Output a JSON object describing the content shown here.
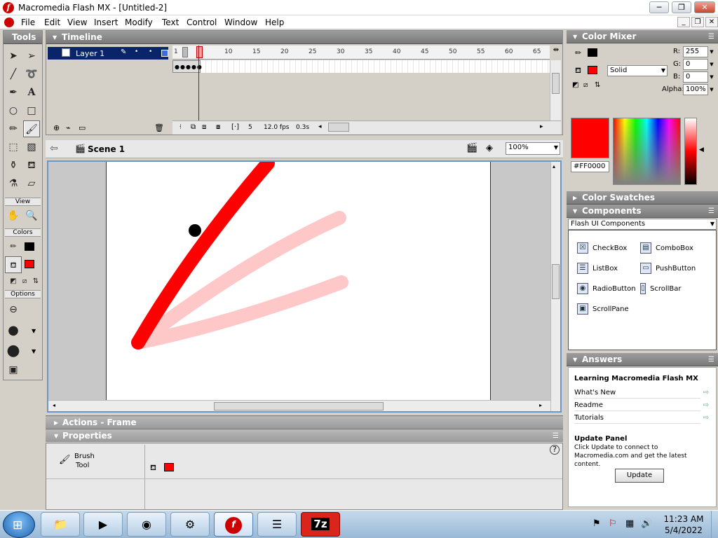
{
  "window": {
    "title": "Macromedia Flash MX - [Untitled-2]",
    "minimize": "─",
    "maximize": "❐",
    "close": "✕"
  },
  "menu": [
    "File",
    "Edit",
    "View",
    "Insert",
    "Modify",
    "Text",
    "Control",
    "Window",
    "Help"
  ],
  "tools_panel": {
    "title": "Tools",
    "sections": {
      "view": "View",
      "colors": "Colors",
      "options": "Options"
    }
  },
  "timeline": {
    "title": "Timeline",
    "layer_name": "Layer 1",
    "frame_numbers": [
      "1",
      "5",
      "10",
      "15",
      "20",
      "25",
      "30",
      "35",
      "40",
      "45",
      "50",
      "55",
      "60",
      "65"
    ],
    "current_frame": "5",
    "fps": "12.0 fps",
    "elapsed": "0.3s"
  },
  "scene": {
    "name": "Scene 1",
    "zoom": "100%"
  },
  "panels": {
    "actions": "Actions - Frame",
    "properties": "Properties"
  },
  "properties": {
    "tool_name_line1": "Brush",
    "tool_name_line2": "Tool"
  },
  "color_mixer": {
    "title": "Color Mixer",
    "r_label": "R:",
    "r": "255",
    "g_label": "G:",
    "g": "0",
    "b_label": "B:",
    "b": "0",
    "alpha_label": "Alpha:",
    "alpha": "100%",
    "fill_type": "Solid",
    "hex": "#FF0000"
  },
  "color_swatches": {
    "title": "Color Swatches"
  },
  "components": {
    "title": "Components",
    "set": "Flash UI Components",
    "items": [
      "CheckBox",
      "ComboBox",
      "ListBox",
      "PushButton",
      "RadioButton",
      "ScrollBar",
      "ScrollPane"
    ]
  },
  "answers": {
    "title": "Answers",
    "heading": "Learning Macromedia Flash MX",
    "links": [
      "What's New",
      "Readme",
      "Tutorials"
    ],
    "update_heading": "Update Panel",
    "update_text": "Click Update to connect to Macromedia.com and get the latest content.",
    "update_button": "Update"
  },
  "taskbar": {
    "time": "11:23 AM",
    "date": "5/4/2022",
    "buttons": [
      "file-explorer-icon",
      "media-player-icon",
      "chrome-icon",
      "installer-icon",
      "flash-icon",
      "list-icon",
      "7zip-icon"
    ],
    "sevenzip": "7z"
  },
  "colors": {
    "stroke": "#000000",
    "fill": "#ff0000",
    "stroke_onion": "#ffb6b6",
    "selected_layer": "#0a246a"
  }
}
